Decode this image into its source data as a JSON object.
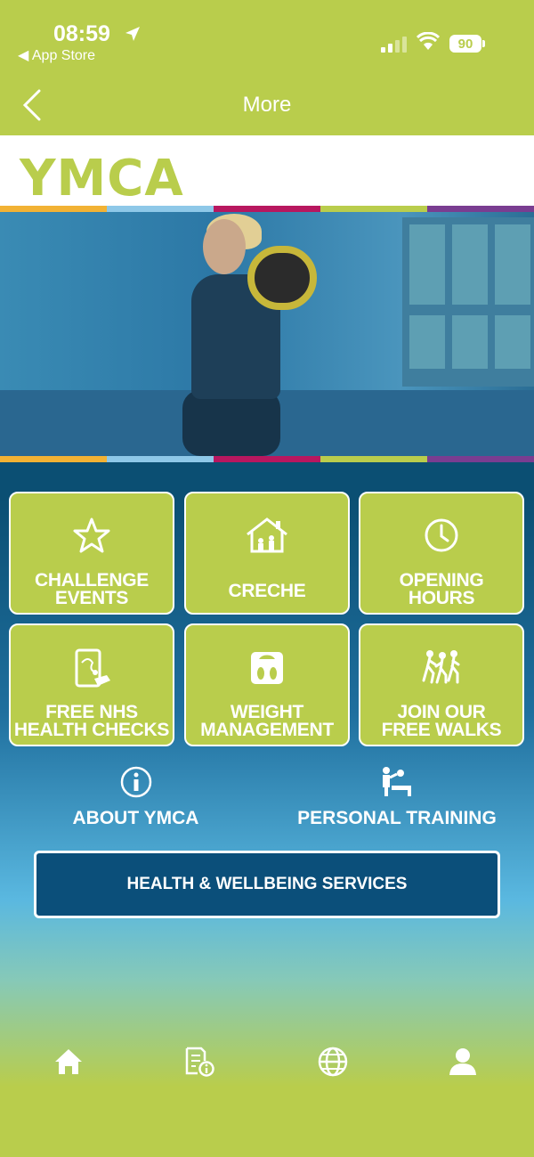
{
  "status": {
    "time": "08:59",
    "back_app": "◀ App Store",
    "battery": "90"
  },
  "header": {
    "title": "More"
  },
  "logo": {
    "text": "YMCA"
  },
  "stripe_colors": [
    "#f2b234",
    "#8ec8e8",
    "#b8175f",
    "#b9cd4c",
    "#7a3d91"
  ],
  "tiles": [
    {
      "label": "CHALLENGE\nEVENTS",
      "icon": "star-icon"
    },
    {
      "label": "CRECHE",
      "icon": "house-icon"
    },
    {
      "label": "OPENING\nHOURS",
      "icon": "clock-icon"
    },
    {
      "label": "FREE NHS\nHEALTH CHECKS",
      "icon": "tablet-health-icon"
    },
    {
      "label": "WEIGHT\nMANAGEMENT",
      "icon": "scale-icon"
    },
    {
      "label": "JOIN OUR\nFREE WALKS",
      "icon": "walkers-icon"
    }
  ],
  "links": {
    "about": "ABOUT YMCA",
    "training": "PERSONAL TRAINING"
  },
  "wellbeing_button": "HEALTH & WELLBEING SERVICES",
  "tabbar": [
    "home-icon",
    "document-info-icon",
    "globe-icon",
    "profile-icon"
  ],
  "colors": {
    "brand_green": "#b9cd4c",
    "navy": "#0b4f7a"
  }
}
